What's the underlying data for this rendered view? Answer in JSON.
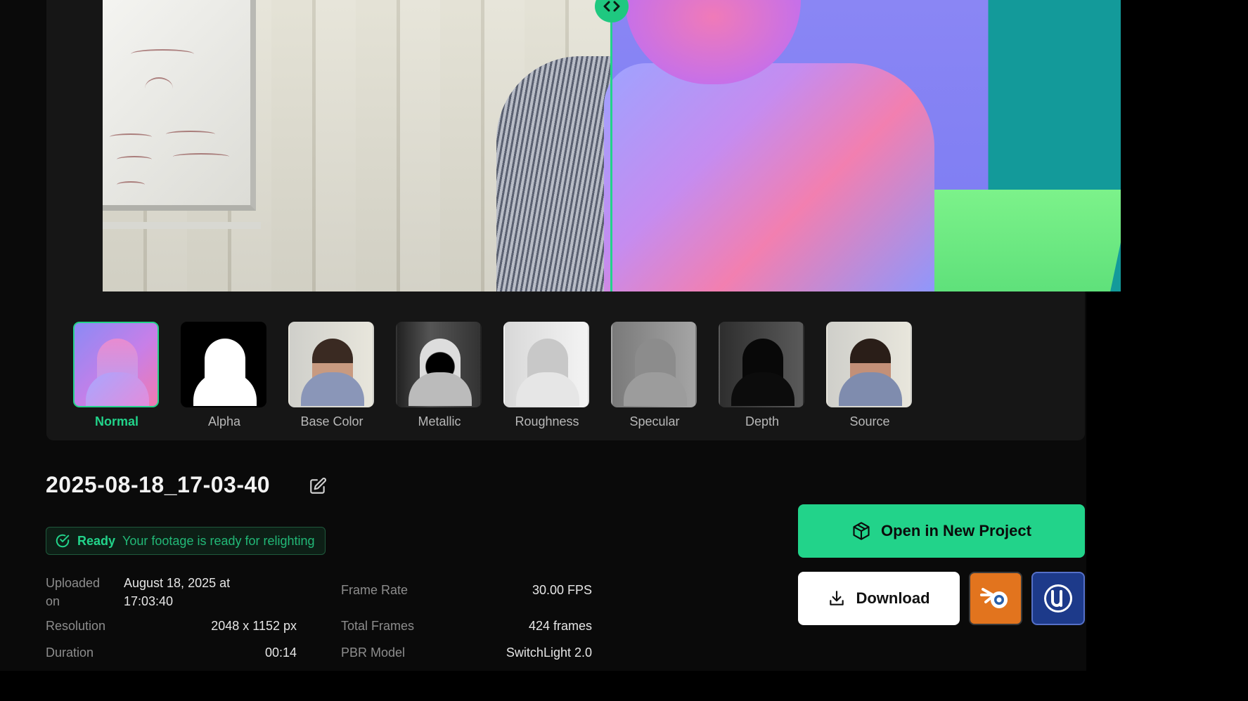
{
  "viewer": {
    "divider_icon": "code-arrows-icon",
    "split_left": "source",
    "split_right": "normal"
  },
  "thumbnails": [
    {
      "label": "Normal",
      "active": true
    },
    {
      "label": "Alpha",
      "active": false
    },
    {
      "label": "Base Color",
      "active": false
    },
    {
      "label": "Metallic",
      "active": false
    },
    {
      "label": "Roughness",
      "active": false
    },
    {
      "label": "Specular",
      "active": false
    },
    {
      "label": "Depth",
      "active": false
    },
    {
      "label": "Source",
      "active": false
    }
  ],
  "details": {
    "title": "2025-08-18_17-03-40",
    "status": {
      "word": "Ready",
      "message": "Your footage is ready for relighting"
    },
    "uploaded_label_line1": "Uploaded",
    "uploaded_label_line2": "on",
    "uploaded_value_line1": "August 18, 2025 at",
    "uploaded_value_line2": "17:03:40",
    "resolution_label": "Resolution",
    "resolution_value": "2048 x 1152 px",
    "duration_label": "Duration",
    "duration_value": "00:14",
    "frame_rate_label": "Frame Rate",
    "frame_rate_value": "30.00 FPS",
    "total_frames_label": "Total Frames",
    "total_frames_value": "424 frames",
    "pbr_model_label": "PBR Model",
    "pbr_model_value": "SwitchLight 2.0"
  },
  "actions": {
    "open_label": "Open in New Project",
    "download_label": "Download",
    "blender_icon": "blender-icon",
    "unreal_icon": "unreal-engine-icon"
  },
  "colors": {
    "accent": "#22d38a",
    "background": "#0a0a0a",
    "panel": "#161616",
    "blender": "#e2741e",
    "unreal": "#1d3a8a"
  }
}
